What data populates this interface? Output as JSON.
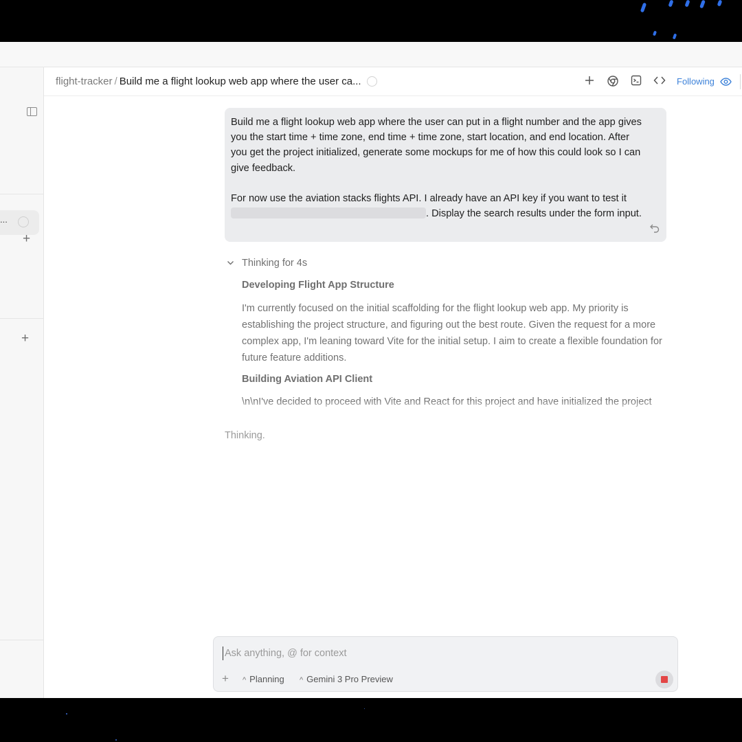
{
  "breadcrumb": {
    "project": "flight-tracker",
    "separator": "/",
    "conversation_title": "Build me a flight lookup web app where the user ca..."
  },
  "header": {
    "icons": [
      "plus-icon",
      "chrome-icon",
      "terminal-icon",
      "code-icon"
    ],
    "following_label": "Following",
    "following_icon": "eye-icon"
  },
  "sidebar": {
    "active_item_label": "..."
  },
  "user_message": {
    "paragraph1": "Build me a flight lookup web app where the user can put in a flight number and the app gives you the start time + time zone, end time + time zone, start location, and end location. After you get the project initialized, generate some mockups for me of how this could look so I can give feedback.",
    "paragraph2_before": "For now use the aviation stacks flights API. I already have an API key if you want to test it ",
    "paragraph2_after": ". Display the search results under the form input."
  },
  "thinking": {
    "label": "Thinking for 4s",
    "sections": [
      {
        "heading": "Developing Flight App Structure",
        "body": "I'm currently focused on the initial scaffolding for the flight lookup web app. My priority is establishing the project structure, and figuring out the best route. Given the request for a more complex app, I'm leaning toward Vite for the initial setup. I aim to create a flexible foundation for future feature additions."
      },
      {
        "heading": "Building Aviation API Client",
        "body": "\\n\\nI've decided to proceed with Vite and React for this project and have initialized the project scaffolding. The next step involves building out some mockups of the flight"
      }
    ],
    "status": "Thinking."
  },
  "composer": {
    "placeholder": "Ask anything, @ for context",
    "mode_label": "Planning",
    "model_label": "Gemini 3 Pro Preview"
  },
  "colors": {
    "accent": "#3d82d9",
    "stop": "#e34545",
    "message_bg": "#ebecee"
  }
}
